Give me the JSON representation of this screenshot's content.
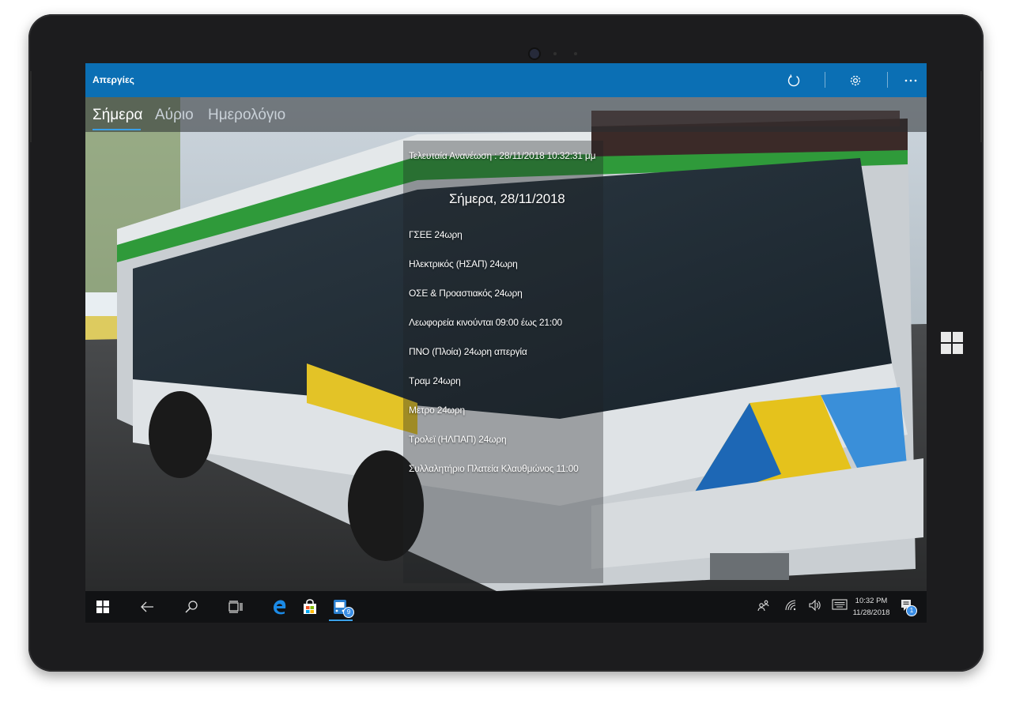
{
  "app": {
    "title": "Απεργίες",
    "accent_color": "#0b6fb4"
  },
  "titlebar": {
    "icons": [
      "refresh-icon",
      "settings-gear-icon",
      "more-ellipsis-icon"
    ]
  },
  "pivot": {
    "tabs": [
      {
        "label": "Σήμερα",
        "active": true
      },
      {
        "label": "Αύριο",
        "active": false
      },
      {
        "label": "Ημερολόγιο",
        "active": false
      }
    ]
  },
  "content": {
    "last_update": "Τελευταία Ανανέωση : 28/11/2018 10:32:31 μμ",
    "heading": "Σήμερα, 28/11/2018",
    "strikes": [
      "ΓΣΕΕ 24ωρη",
      "Ηλεκτρικός (ΗΣΑΠ) 24ωρη",
      "ΟΣΕ & Προαστιακός 24ωρη",
      "Λεωφορεία  κινούνται 09:00 έως 21:00",
      "ΠΝΟ (Πλοία) 24ωρη απεργία",
      "Τραμ 24ωρη",
      "Μετρο 24ωρη",
      "Τρολεϊ (ΗΛΠΑΠ) 24ωρη",
      "Συλλαλητήριο Πλατεία Κλαυθμώνος 11:00"
    ],
    "background_image": "athens-city-bus"
  },
  "taskbar": {
    "icons": [
      "windows-start-icon",
      "back-arrow-icon",
      "search-icon",
      "task-view-icon",
      "edge-browser-icon",
      "store-bag-icon",
      "strikes-app-icon"
    ],
    "app_badge": "9",
    "tray_icons": [
      "people-icon",
      "wifi-icon",
      "volume-icon",
      "keyboard-icon",
      "action-center-icon"
    ],
    "time": "10:32 PM",
    "date": "11/28/2018",
    "notification_count": "1"
  }
}
